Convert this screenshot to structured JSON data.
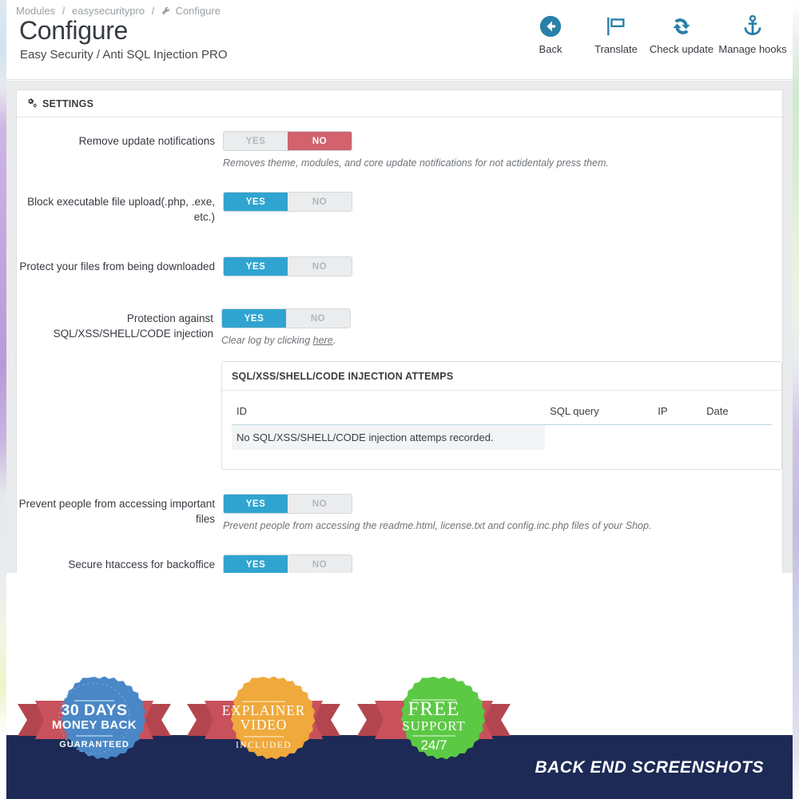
{
  "breadcrumb": {
    "items": [
      "Modules",
      "easysecuritypro",
      "Configure"
    ],
    "separator": "/",
    "last_icon": "wrench-icon"
  },
  "header": {
    "title": "Configure",
    "subtitle": "Easy Security / Anti SQL Injection PRO"
  },
  "toolbar": [
    {
      "label": "Back",
      "icon": "arrow-left-circle-icon"
    },
    {
      "label": "Translate",
      "icon": "flag-icon"
    },
    {
      "label": "Check update",
      "icon": "refresh-icon"
    },
    {
      "label": "Manage hooks",
      "icon": "anchor-icon"
    }
  ],
  "settings_panel": {
    "title": "SETTINGS",
    "icon": "gears-icon",
    "yes_label": "YES",
    "no_label": "NO",
    "rows": [
      {
        "label": "Remove update notifications",
        "value": "NO",
        "help": "Removes theme, modules, and core update notifications for not actidentaly press them."
      },
      {
        "label": "Block executable file upload(.php, .exe, etc.)",
        "value": "YES",
        "help": ""
      },
      {
        "label": "Protect your files from being downloaded",
        "value": "YES",
        "help": ""
      },
      {
        "label": "Protection against SQL/XSS/SHELL/CODE injection",
        "value": "YES",
        "help_prefix": "Clear log by clicking ",
        "help_link": "here",
        "help_suffix": "."
      },
      {
        "label": "Prevent people from accessing important files",
        "value": "YES",
        "help": "Prevent people from accessing the readme.html, license.txt and config.inc.php files of your Shop."
      },
      {
        "label": "Secure htaccess for backoffice",
        "value": "YES",
        "help": ""
      }
    ]
  },
  "attempts_panel": {
    "title": "SQL/XSS/SHELL/CODE INJECTION ATTEMPS",
    "columns": [
      "ID",
      "SQL query",
      "IP",
      "Date"
    ],
    "empty_message": "No SQL/XSS/SHELL/CODE injection attemps recorded.",
    "rows": []
  },
  "promo": {
    "footer_text": "BACK END SCREENSHOTS",
    "badges": [
      {
        "line1": "30 DAYS",
        "line2": "MONEY BACK",
        "line3": "GUARANTEED",
        "color": "#4a87c6"
      },
      {
        "line1": "EXPLAINER",
        "line2": "VIDEO",
        "line3": "INCLUDED",
        "color": "#efa93c"
      },
      {
        "line1": "FREE",
        "line2": "SUPPORT",
        "line3": "24/7",
        "color": "#5dc council"
      }
    ]
  },
  "colors": {
    "toggle_on": "#2fa4d0",
    "toggle_off_bg": "#ebeced",
    "toggle_no": "#d1626e",
    "content_bg": "#e9ebec",
    "band": "#1c2a55",
    "ribbon": "#c9515b"
  }
}
